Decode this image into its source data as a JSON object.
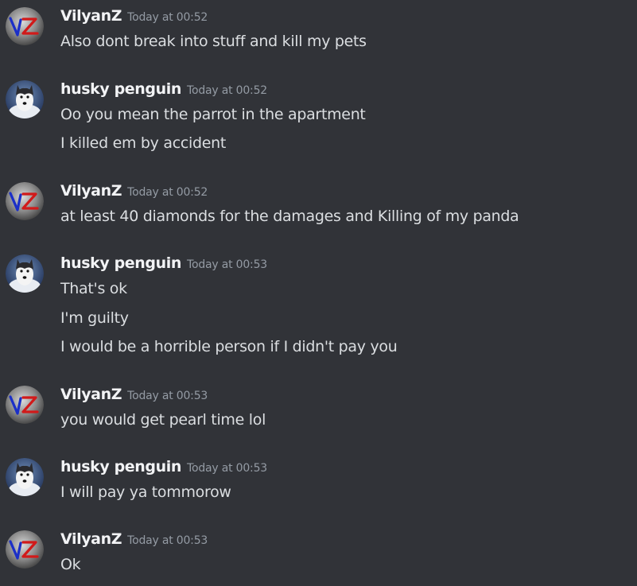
{
  "avatars": {
    "vilyanz": "vz-logo-avatar",
    "husky": "husky-dog-avatar"
  },
  "groups": [
    {
      "author": "VilyanZ",
      "time": "Today at 00:52",
      "messages": [
        "Also dont break into stuff and kill my pets"
      ]
    },
    {
      "author": "husky penguin",
      "time": "Today at 00:52",
      "messages": [
        "Oo you mean the parrot in the apartment",
        "I killed em by accident"
      ]
    },
    {
      "author": "VilyanZ",
      "time": "Today at 00:52",
      "messages": [
        "at least 40 diamonds for the damages and Killing of my panda"
      ]
    },
    {
      "author": "husky penguin",
      "time": "Today at 00:53",
      "messages": [
        "That's ok",
        "I'm guilty",
        "I would be a horrible person if I didn't pay you"
      ]
    },
    {
      "author": "VilyanZ",
      "time": "Today at 00:53",
      "messages": [
        "you would get pearl time lol"
      ]
    },
    {
      "author": "husky penguin",
      "time": "Today at 00:53",
      "messages": [
        "I will pay ya tommorow"
      ]
    },
    {
      "author": "VilyanZ",
      "time": "Today at 00:53",
      "messages": [
        "Ok"
      ]
    }
  ]
}
